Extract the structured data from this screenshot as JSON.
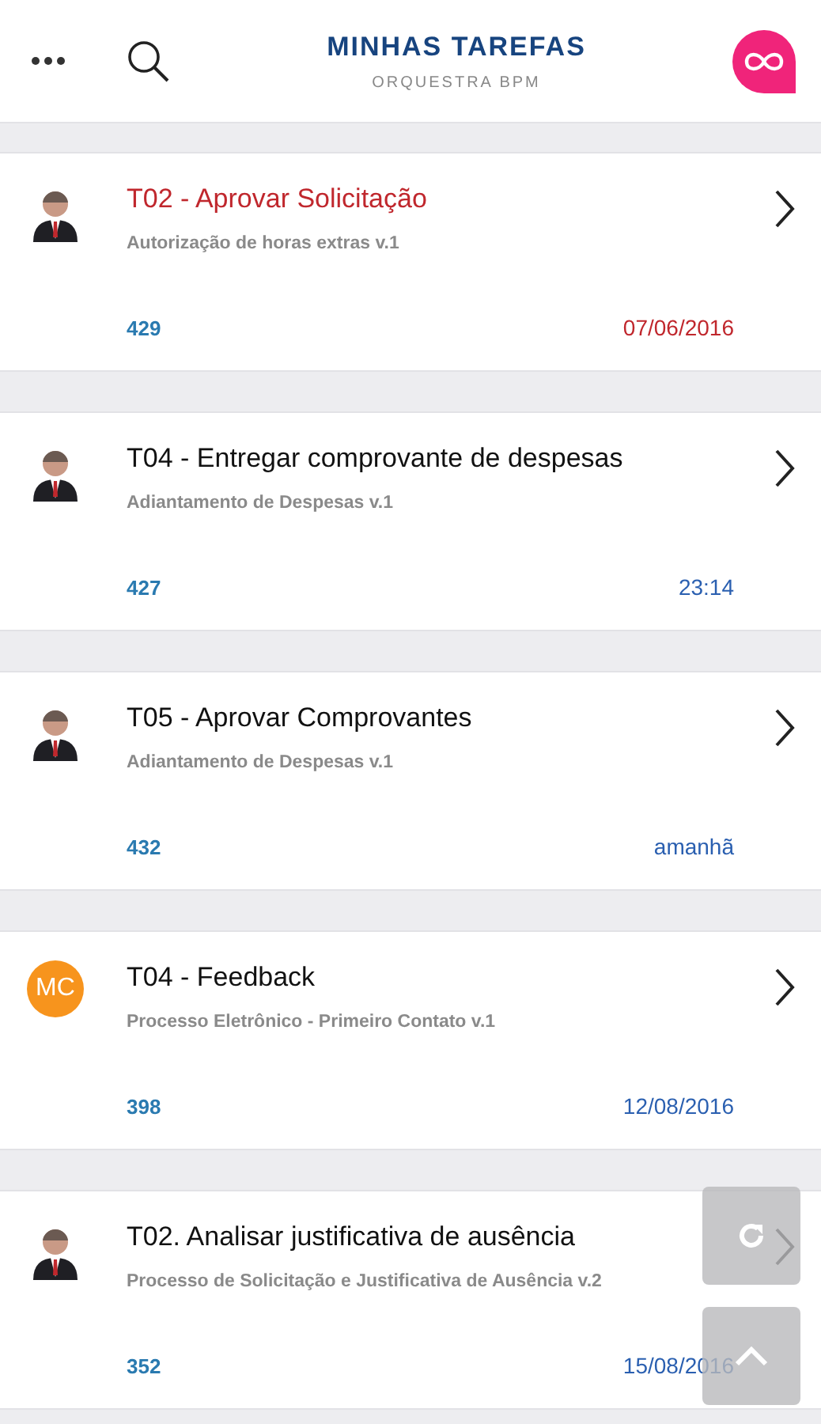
{
  "header": {
    "title": "MINHAS TAREFAS",
    "subtitle": "ORQUESTRA BPM"
  },
  "tasks": [
    {
      "title": "T02 - Aprovar Solicitação",
      "process": "Autorização de horas extras v.1",
      "number": "429",
      "due": "07/06/2016",
      "overdue": true,
      "avatar": {
        "kind": "photo"
      }
    },
    {
      "title": "T04 - Entregar comprovante de despesas",
      "process": "Adiantamento de Despesas v.1",
      "number": "427",
      "due": "23:14",
      "overdue": false,
      "avatar": {
        "kind": "photo"
      }
    },
    {
      "title": "T05 - Aprovar Comprovantes",
      "process": "Adiantamento de Despesas v.1",
      "number": "432",
      "due": "amanhã",
      "overdue": false,
      "avatar": {
        "kind": "photo"
      }
    },
    {
      "title": "T04 - Feedback",
      "process": "Processo Eletrônico - Primeiro Contato v.1",
      "number": "398",
      "due": "12/08/2016",
      "overdue": false,
      "avatar": {
        "kind": "initials",
        "text": "MC",
        "color": "#f7941d"
      }
    },
    {
      "title": "T02. Analisar justificativa de ausência",
      "process": "Processo de Solicitação e Justificativa de Ausência v.2",
      "number": "352",
      "due": "15/08/2016",
      "overdue": false,
      "avatar": {
        "kind": "photo"
      }
    }
  ]
}
